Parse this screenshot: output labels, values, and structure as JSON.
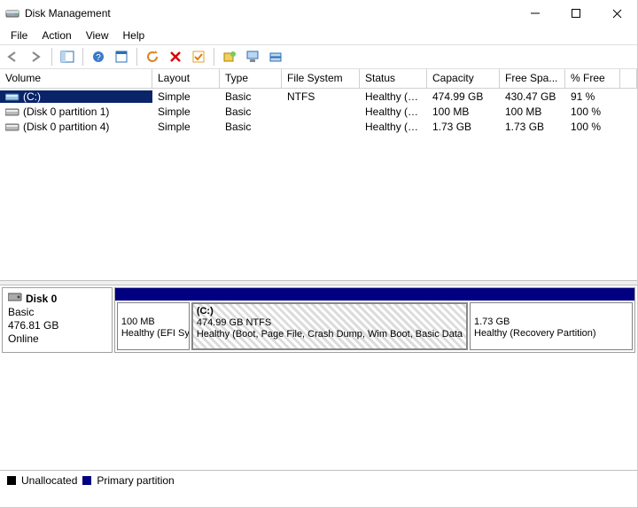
{
  "window": {
    "title": "Disk Management"
  },
  "menu": {
    "file": "File",
    "action": "Action",
    "view": "View",
    "help": "Help"
  },
  "columns": {
    "volume": "Volume",
    "layout": "Layout",
    "type": "Type",
    "fs": "File System",
    "status": "Status",
    "capacity": "Capacity",
    "free": "Free Spa...",
    "pfree": "% Free"
  },
  "rows": [
    {
      "volume": "(C:)",
      "layout": "Simple",
      "type": "Basic",
      "fs": "NTFS",
      "status": "Healthy (B...",
      "capacity": "474.99 GB",
      "free": "430.47 GB",
      "pfree": "91 %",
      "selected": true
    },
    {
      "volume": "(Disk 0 partition 1)",
      "layout": "Simple",
      "type": "Basic",
      "fs": "",
      "status": "Healthy (E...",
      "capacity": "100 MB",
      "free": "100 MB",
      "pfree": "100 %",
      "selected": false
    },
    {
      "volume": "(Disk 0 partition 4)",
      "layout": "Simple",
      "type": "Basic",
      "fs": "",
      "status": "Healthy (R...",
      "capacity": "1.73 GB",
      "free": "1.73 GB",
      "pfree": "100 %",
      "selected": false
    }
  ],
  "disk": {
    "name": "Disk 0",
    "type": "Basic",
    "size": "476.81 GB",
    "state": "Online"
  },
  "parts": {
    "p0": {
      "line1": "100 MB",
      "line2": "Healthy (EFI System"
    },
    "p1": {
      "title": "(C:)",
      "line1": "474.99 GB NTFS",
      "line2": "Healthy (Boot, Page File, Crash Dump, Wim Boot, Basic Data"
    },
    "p2": {
      "line1": "1.73 GB",
      "line2": "Healthy (Recovery Partition)"
    }
  },
  "legend": {
    "unalloc": "Unallocated",
    "primary": "Primary partition"
  },
  "colors": {
    "primary": "#000080",
    "unalloc": "#000000"
  }
}
